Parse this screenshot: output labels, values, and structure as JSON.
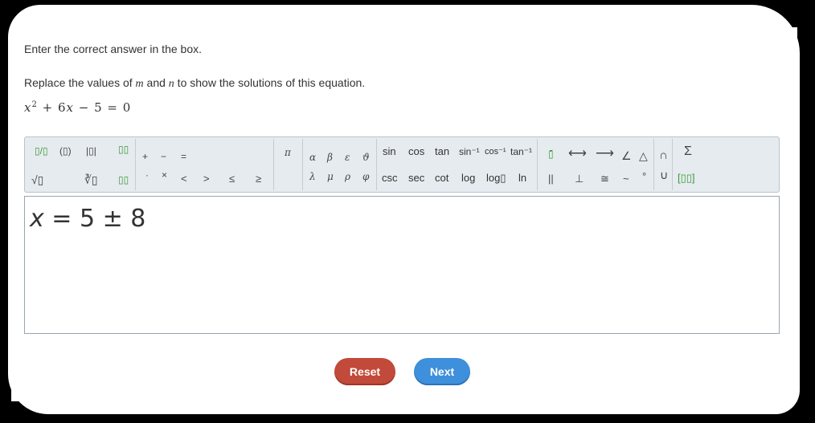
{
  "instruction": "Enter the correct answer in the box.",
  "question": {
    "prefix": "Replace the values of ",
    "var_m": "m",
    "middle": " and ",
    "var_n": "n",
    "suffix": " to show the solutions of this equation."
  },
  "equation": {
    "x": "x",
    "sq": "2",
    "rest": " + 6",
    "x2": "x",
    "tail": " − 5 = 0"
  },
  "toolbar": {
    "row1": [
      "▯/▯",
      "(▯)",
      "|▯|",
      "▯▯",
      "+",
      "−",
      "=",
      "π",
      "α",
      "β",
      "ε",
      "ϑ",
      "sin",
      "cos",
      "tan",
      "sin⁻¹",
      "cos⁻¹",
      "tan⁻¹",
      "▯̄",
      "⟷",
      "⟶",
      "∠",
      "△",
      "∩",
      "Σ"
    ],
    "row2": [
      "√▯",
      "∛▯",
      "▯▯",
      "·",
      "×",
      "<",
      ">",
      "≤",
      "≥",
      "λ",
      "μ",
      "ρ",
      "φ",
      "csc",
      "sec",
      "cot",
      "log",
      "log▯",
      "ln",
      "||",
      "⊥",
      "≅",
      "~",
      "°",
      "∪",
      "[▯▯]"
    ]
  },
  "answer": {
    "var": "x",
    "expr": " = 5 ± 8"
  },
  "buttons": {
    "reset": "Reset",
    "next": "Next"
  },
  "colors": {
    "reset": "#c24a3a",
    "next": "#3e8fdc",
    "toolbar_bg": "#e6ebef",
    "green_template": "#3a9a3a"
  }
}
